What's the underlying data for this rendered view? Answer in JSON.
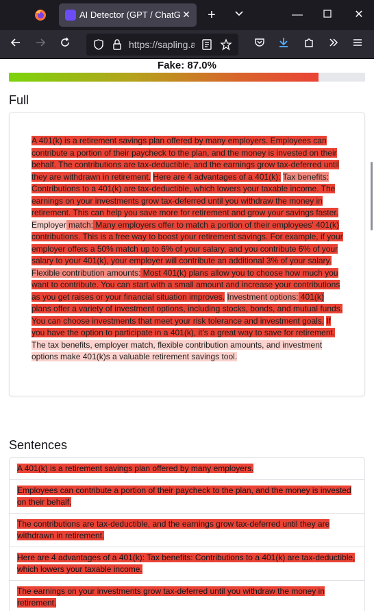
{
  "browser": {
    "tab_title": "AI Detector (GPT / ChatGPT / Claude)",
    "tab_close": "✕",
    "new_tab": "+",
    "list_tabs": "⌄",
    "minimize": "—",
    "maximize": "☐",
    "close": "✕",
    "url": "https://sapling.ai/ai-content-detector",
    "icons": [
      "firefox-icon",
      "back-icon",
      "forward-icon",
      "reload-icon",
      "shield-icon",
      "lock-icon",
      "reader-icon",
      "bookmark-star-icon",
      "pocket-icon",
      "download-icon",
      "extensions-icon",
      "overflow-icon",
      "menu-icon"
    ]
  },
  "result": {
    "fake_label": "Fake: 87.0%",
    "fake_fraction": 0.87
  },
  "colors": {
    "high": "#ea4335",
    "mid": "#f28a80",
    "low": "#fbd2cd"
  },
  "full": {
    "heading": "Full",
    "segments": [
      {
        "text": "A 401(k) is a retirement savings plan offered by many employers. Employees can contribute a portion of their paycheck to the plan, and the money is invested on their behalf. The contributions are tax-deductible, and the earnings grow tax-deferred until they are withdrawn in retirement.",
        "level": "high"
      },
      {
        "text": " ",
        "level": "none"
      },
      {
        "text": "Here are 4 advantages of a 401(k):",
        "level": "high"
      },
      {
        "text": " ",
        "level": "none"
      },
      {
        "text": "Tax benefits:",
        "level": "mid"
      },
      {
        "text": " Contributions to a 401(k) are tax-deductible, which lowers your taxable income. The earnings on your investments grow tax-deferred until you withdraw the money in retirement. This can help you save more for retirement and grow your savings faster.",
        "level": "high"
      },
      {
        "text": " ",
        "level": "none"
      },
      {
        "text": "Employer",
        "level": "low"
      },
      {
        "text": " match:",
        "level": "mid"
      },
      {
        "text": " Many employers offer to match a portion of their employees' 401(k) contributions. This is a free way to boost your retirement savings. For example, if your employer offers a 50% match up to 6% of your salary, and you contribute 6% of your salary to your 401(k), your employer will contribute an additional 3% of your salary.",
        "level": "high"
      },
      {
        "text": " ",
        "level": "none"
      },
      {
        "text": "Flexible contribution amounts:",
        "level": "mid"
      },
      {
        "text": " Most 401(k) plans allow you to choose how much you want to contribute. You can start with a small amount and increase your contributions as you get raises or your financial situation improves.",
        "level": "high"
      },
      {
        "text": " ",
        "level": "none"
      },
      {
        "text": "Investment options:",
        "level": "mid"
      },
      {
        "text": " 401(k) plans offer a variety of investment options, including stocks, bonds, and mutual funds. You can choose investments that meet your risk tolerance and investment goals.",
        "level": "high"
      },
      {
        "text": " ",
        "level": "none"
      },
      {
        "text": "If you have the option to participate in a 401(k), it's a great way to save for retirement.",
        "level": "high"
      },
      {
        "text": " ",
        "level": "none"
      },
      {
        "text": "The tax benefits, employer match, flexible contribution amounts, and investment options make 401(k)s a valuable retirement savings tool.",
        "level": "low"
      }
    ]
  },
  "sentences": {
    "heading": "Sentences",
    "items": [
      {
        "text": "A 401(k) is a retirement savings plan offered by many employers.",
        "level": "high"
      },
      {
        "text": "Employees can contribute a portion of their paycheck to the plan, and the money is invested on their behalf.",
        "level": "high"
      },
      {
        "text": "The contributions are tax-deductible, and the earnings grow tax-deferred until they are withdrawn in retirement.",
        "level": "high"
      },
      {
        "text": "Here are 4 advantages of a 401(k): Tax benefits: Contributions to a 401(k) are tax-deductible, which lowers your taxable income.",
        "level": "high"
      },
      {
        "text": "The earnings on your investments grow tax-deferred until you withdraw the money in retirement.",
        "level": "high"
      }
    ]
  }
}
